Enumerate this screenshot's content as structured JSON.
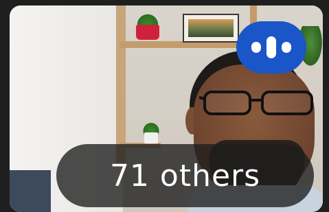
{
  "tile": {
    "participants_label": "71 others"
  },
  "icons": {
    "audio_indicator": "audio-level-icon"
  },
  "colors": {
    "audio_badge": "#1a56c8",
    "pill_bg": "#1e1e1e",
    "label_text": "#ffffff"
  }
}
